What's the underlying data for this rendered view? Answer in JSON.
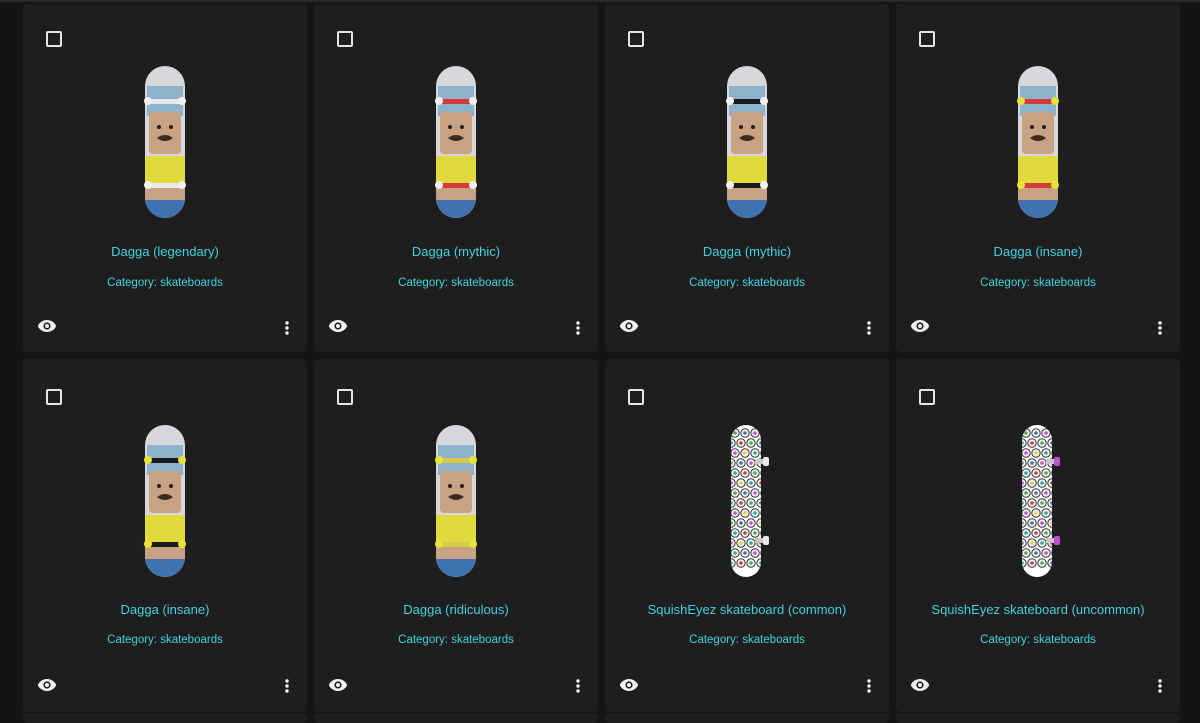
{
  "cards": [
    {
      "title": "Dagga (legendary)",
      "category": "Category: skateboards",
      "image": "dagga-skateboard-image",
      "truck_color": "#e8e8e8",
      "wheel_color": "#f2f2f2"
    },
    {
      "title": "Dagga (mythic)",
      "category": "Category: skateboards",
      "image": "dagga-skateboard-image",
      "truck_color": "#d83a3a",
      "wheel_color": "#f2f2f2"
    },
    {
      "title": "Dagga (mythic)",
      "category": "Category: skateboards",
      "image": "dagga-skateboard-image",
      "truck_color": "#1a1a1a",
      "wheel_color": "#f2f2f2"
    },
    {
      "title": "Dagga (insane)",
      "category": "Category: skateboards",
      "image": "dagga-skateboard-image",
      "truck_color": "#d83a3a",
      "wheel_color": "#e8e23a"
    },
    {
      "title": "Dagga (insane)",
      "category": "Category: skateboards",
      "image": "dagga-skateboard-image",
      "truck_color": "#1a1a1a",
      "wheel_color": "#e8e23a"
    },
    {
      "title": "Dagga (ridiculous)",
      "category": "Category: skateboards",
      "image": "dagga-skateboard-image",
      "truck_color": "#d8c84a",
      "wheel_color": "#e8e23a"
    },
    {
      "title": "SquishEyez skateboard (common)",
      "category": "Category: skateboards",
      "image": "squisheyez-skateboard-image",
      "truck_color": "#c8c8c8",
      "wheel_color": "#e8e8e8"
    },
    {
      "title": "SquishEyez skateboard (uncommon)",
      "category": "Category: skateboards",
      "image": "squisheyez-skateboard-image",
      "truck_color": "#c8c8c8",
      "wheel_color": "#c84ad8"
    }
  ],
  "icons": {
    "view": "eye-icon",
    "menu": "more-vert-icon",
    "select": "checkbox-icon"
  },
  "colors": {
    "accent": "#3fd3e0",
    "card": "#1e1e1e",
    "background": "#141414"
  }
}
